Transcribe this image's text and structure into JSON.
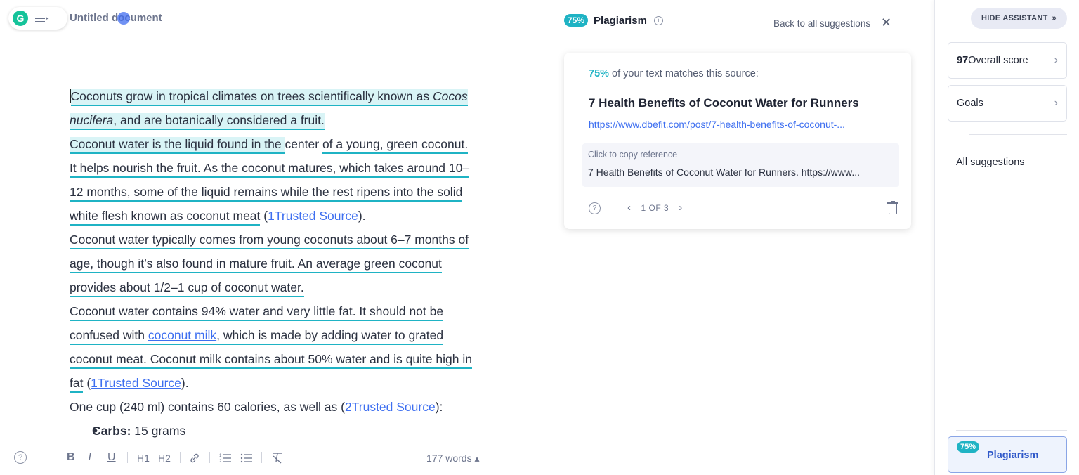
{
  "header": {
    "doc_title": "Untitled document"
  },
  "editor": {
    "lines": [
      [
        "Coconuts grow in tropical climates on trees scientifically known as ",
        "Cocos "
      ],
      [
        "nucifera",
        ", and are botanically considered a fruit."
      ],
      [
        "Coconut water is the liquid found in the ",
        "center ",
        "of a young, green coconut."
      ],
      [
        "It helps nourish the fruit. As the coconut matures, which takes around 10–"
      ],
      [
        "12 months, some of the liquid remains while the rest ripens into the solid"
      ],
      [
        "white flesh known as coconut meat",
        " (",
        "1Trusted Source",
        ")."
      ],
      [
        "Coconut water typically comes from young coconuts about 6–7 months of"
      ],
      [
        "age, though it’s also found in mature fruit. An average green coconut"
      ],
      [
        "provides about 1/2–1 cup of coconut water."
      ],
      [
        "Coconut water contains 94% water and very little fat. It should not be"
      ],
      [
        "confused with ",
        "coconut milk",
        ", which is made by adding water to grated"
      ],
      [
        "coconut meat. Coconut milk contains about 50% water and is quite high in"
      ],
      [
        "fat",
        " (",
        "1Trusted Source",
        ")."
      ],
      [
        "One cup (240 ml) contains 60 calories, as well as (",
        "2Trusted Source",
        "):"
      ]
    ],
    "bullet": {
      "label": "Carbs:",
      "value": " 15 grams"
    }
  },
  "toolbar": {
    "help": "?",
    "bold": "B",
    "italic": "I",
    "underline": "U",
    "h1": "H1",
    "h2": "H2",
    "link_icon": "link-icon",
    "ordered_list_icon": "ordered-list-icon",
    "bullet_list_icon": "bullet-list-icon",
    "clear_format_icon": "clear-format-icon",
    "word_count": "177 words ▴"
  },
  "plagiarism": {
    "badge": "75%",
    "title": "Plagiarism",
    "back_label": "Back to all suggestions",
    "card": {
      "match_pct": "75%",
      "match_text": " of your text matches this source:",
      "source_title": "7 Health Benefits of Coconut Water for Runners",
      "source_url": "https://www.dbefit.com/post/7-health-benefits-of-coconut-...",
      "copy_label": "Click to copy reference",
      "reference_text": "7 Health Benefits of Coconut Water for Runners. https://www...",
      "pager": "1 OF 3"
    }
  },
  "sidebar": {
    "hide_label": "HIDE ASSISTANT",
    "score_value": "97",
    "score_label": " Overall score",
    "goals_label": "Goals",
    "all_suggestions": "All suggestions",
    "plag_badge": "75%",
    "plag_label": "Plagiarism"
  },
  "colors": {
    "brand_green": "#15c39a",
    "match_teal": "#1fb3c4",
    "link_blue": "#3e6ff0"
  }
}
